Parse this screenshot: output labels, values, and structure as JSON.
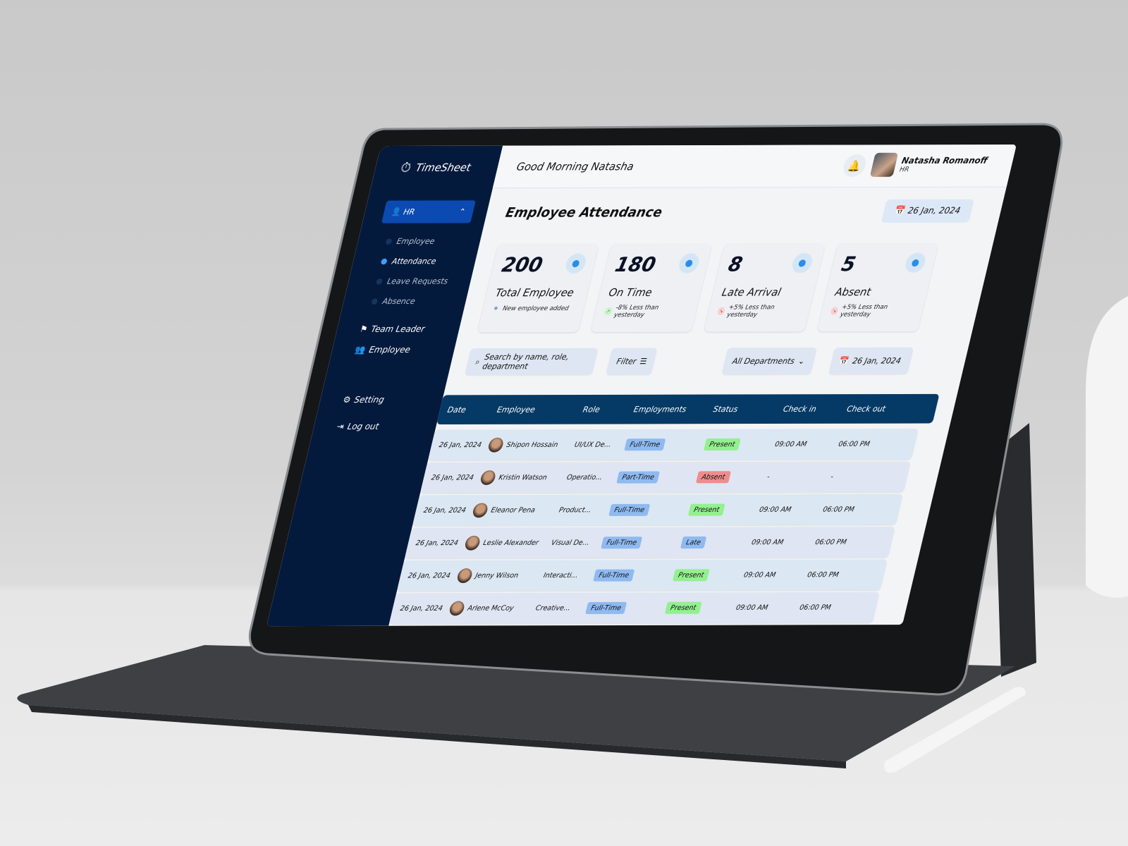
{
  "app": {
    "name": "TimeSheet"
  },
  "sidebar": {
    "role_button": "HR",
    "sub_items": [
      {
        "label": "Employee",
        "active": false
      },
      {
        "label": "Attendance",
        "active": true
      },
      {
        "label": "Leave Requests",
        "active": false
      },
      {
        "label": "Absence",
        "active": false
      }
    ],
    "nav": [
      {
        "label": "Team Leader",
        "icon": "team-icon"
      },
      {
        "label": "Employee",
        "icon": "users-icon"
      }
    ],
    "bottom": [
      {
        "label": "Setting",
        "icon": "gear-icon"
      },
      {
        "label": "Log out",
        "icon": "logout-icon"
      }
    ]
  },
  "header": {
    "greeting": "Good Morning Natasha",
    "user_name": "Natasha Romanoff",
    "user_role": "HR"
  },
  "page": {
    "title": "Employee Attendance",
    "date": "26 Jan, 2024"
  },
  "cards": [
    {
      "value": "200",
      "label": "Total Employee",
      "note": "New employee added",
      "icon": "users-icon",
      "trend": "plus"
    },
    {
      "value": "180",
      "label": "On Time",
      "note": "-8% Less than yesterday",
      "icon": "stopwatch-icon",
      "trend": "up"
    },
    {
      "value": "8",
      "label": "Late Arrival",
      "note": "+5% Less than yesterday",
      "icon": "clock-x-icon",
      "trend": "down"
    },
    {
      "value": "5",
      "label": "Absent",
      "note": "+5% Less than yesterday",
      "icon": "user-icon",
      "trend": "down"
    }
  ],
  "controls": {
    "search_placeholder": "Search by name, role, department",
    "filter": "Filter",
    "department": "All Departments",
    "date": "26 Jan, 2024"
  },
  "table": {
    "columns": [
      "Date",
      "Employee",
      "Role",
      "Employments",
      "Status",
      "Check in",
      "Check out"
    ],
    "rows": [
      {
        "date": "26 Jan, 2024",
        "name": "Shipon Hossain",
        "role": "UI/UX De...",
        "employment": "Full-Time",
        "status": "Present",
        "check_in": "09:00 AM",
        "check_out": "06:00 PM"
      },
      {
        "date": "26 Jan, 2024",
        "name": "Kristin Watson",
        "role": "Operatio...",
        "employment": "Part-Time",
        "status": "Absent",
        "check_in": "-",
        "check_out": "-"
      },
      {
        "date": "26 Jan, 2024",
        "name": "Eleanor Pena",
        "role": "Product...",
        "employment": "Full-Time",
        "status": "Present",
        "check_in": "09:00 AM",
        "check_out": "06:00 PM"
      },
      {
        "date": "26 Jan, 2024",
        "name": "Leslie Alexander",
        "role": "Visual De...",
        "employment": "Full-Time",
        "status": "Late",
        "check_in": "09:00 AM",
        "check_out": "06:00 PM"
      },
      {
        "date": "26 Jan, 2024",
        "name": "Jenny Wilson",
        "role": "Interacti...",
        "employment": "Full-Time",
        "status": "Present",
        "check_in": "09:00 AM",
        "check_out": "06:00 PM"
      },
      {
        "date": "26 Jan, 2024",
        "name": "Arlene McCoy",
        "role": "Creative...",
        "employment": "Full-Time",
        "status": "Present",
        "check_in": "09:00 AM",
        "check_out": "06:00 PM"
      }
    ]
  },
  "colors": {
    "sidebar": "#041a3d",
    "accent": "#0b4ab0",
    "table_header": "#053a66",
    "present": "#93f08f",
    "absent": "#f08c8c",
    "late": "#8fbaf0",
    "employment": "#8fbaf0"
  }
}
